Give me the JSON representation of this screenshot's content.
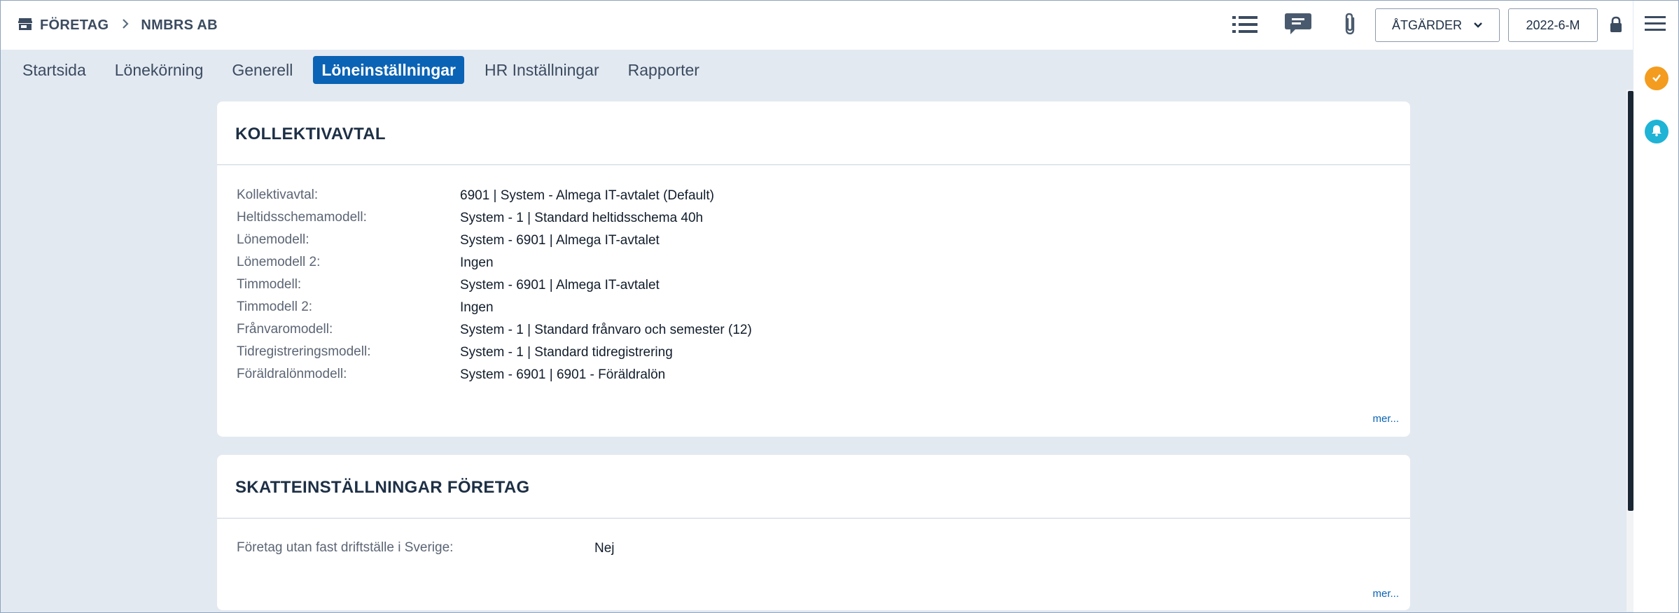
{
  "breadcrumb": {
    "section": "FÖRETAG",
    "company": "NMBRS AB"
  },
  "toolbar": {
    "actions_label": "ÅTGÄRDER",
    "period_label": "2022-6-M"
  },
  "tabs": [
    "Startsida",
    "Lönekörning",
    "Generell",
    "Löneinställningar",
    "HR Inställningar",
    "Rapporter"
  ],
  "active_tab": "Löneinställningar",
  "kollektivavtal": {
    "title": "KOLLEKTIVAVTAL",
    "rows": [
      {
        "label": "Kollektivavtal:",
        "value": "6901 | System - Almega IT-avtalet (Default)"
      },
      {
        "label": "Heltidsschemamodell:",
        "value": "System - 1 | Standard heltidsschema 40h"
      },
      {
        "label": "Lönemodell:",
        "value": "System - 6901 | Almega IT-avtalet"
      },
      {
        "label": "Lönemodell 2:",
        "value": "Ingen"
      },
      {
        "label": "Timmodell:",
        "value": "System - 6901 | Almega IT-avtalet"
      },
      {
        "label": "Timmodell 2:",
        "value": "Ingen"
      },
      {
        "label": "Frånvaromodell:",
        "value": "System - 1 | Standard frånvaro och semester (12)"
      },
      {
        "label": "Tidregistreringsmodell:",
        "value": "System - 1 | Standard tidregistrering"
      },
      {
        "label": "Föräldralönmodell:",
        "value": "System - 6901 | 6901 - Föräldralön"
      }
    ],
    "more": "mer..."
  },
  "skatt": {
    "title": "SKATTEINSTÄLLNINGAR FÖRETAG",
    "rows": [
      {
        "label": "Företag utan fast driftställe i Sverige:",
        "value": "Nej"
      }
    ],
    "more": "mer..."
  },
  "icons": {
    "breadcrumb": "store-icon",
    "separator": "chevron-right-icon",
    "list": "list-icon",
    "chat": "chat-icon",
    "attach": "paperclip-icon",
    "dropdown": "chevron-down-icon",
    "lock": "lock-icon",
    "menu": "hamburger-menu-icon",
    "tasks": "check-icon",
    "notifications": "bell-icon"
  },
  "colors": {
    "accent": "#0a63b5",
    "background": "#e3e9f1",
    "tasks_badge": "#f39c1f",
    "notifications_badge": "#1fb3d6"
  }
}
